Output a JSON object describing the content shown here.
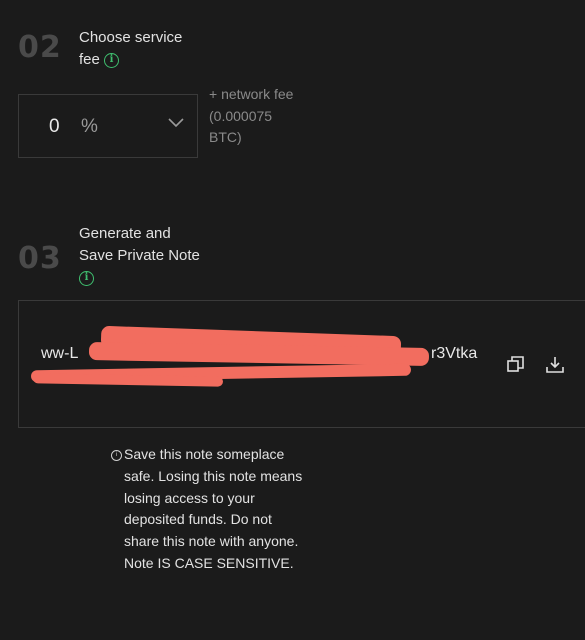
{
  "step2": {
    "number": "02",
    "title_line1": "Choose service",
    "title_line2": "fee",
    "fee_value": "0",
    "fee_unit": "%",
    "network_fee": "+ network fee (0.000075 BTC)"
  },
  "step3": {
    "number": "03",
    "title_line1": "Generate and",
    "title_line2": "Save Private Note",
    "note_prefix": "ww-L",
    "note_suffix": "r3Vtka"
  },
  "warning": {
    "text": "Save this note someplace safe. Losing this note means losing access to your deposited funds. Do not share this note with anyone. Note IS CASE SENSITIVE."
  },
  "colors": {
    "background": "#1b1b1b",
    "accent_green": "#3fbf6f",
    "redaction": "#f26d5f"
  },
  "icons": {
    "info": "info-icon",
    "chevron": "chevron-down-icon",
    "copy": "copy-icon",
    "download": "download-icon"
  }
}
